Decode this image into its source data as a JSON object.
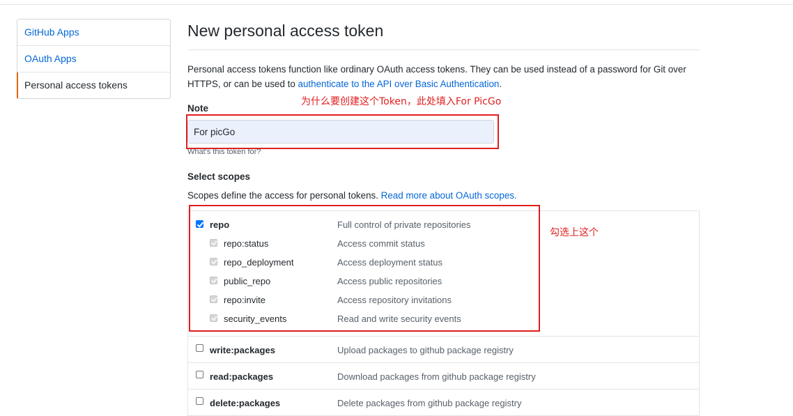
{
  "sidebar": {
    "items": [
      {
        "label": "GitHub Apps"
      },
      {
        "label": "OAuth Apps"
      },
      {
        "label": "Personal access tokens"
      }
    ]
  },
  "main": {
    "title": "New personal access token",
    "intro_text": "Personal access tokens function like ordinary OAuth access tokens. They can be used instead of a password for Git over HTTPS, or can be used to ",
    "intro_link": "authenticate to the API over Basic Authentication",
    "intro_end": ".",
    "note_label": "Note",
    "note_value": "For picGo",
    "note_hint": "What's this token for?",
    "scopes_label": "Select scopes",
    "scopes_desc": "Scopes define the access for personal tokens. ",
    "scopes_link": "Read more about OAuth scopes."
  },
  "annotations": {
    "note": "为什么要创建这个Token，此处填入For PicGo",
    "repo": "勾选上这个",
    "color": "#e01e1e"
  },
  "scopes": {
    "repo": {
      "name": "repo",
      "desc": "Full control of private repositories",
      "checked": true
    },
    "repo_children": [
      {
        "name": "repo:status",
        "desc": "Access commit status"
      },
      {
        "name": "repo_deployment",
        "desc": "Access deployment status"
      },
      {
        "name": "public_repo",
        "desc": "Access public repositories"
      },
      {
        "name": "repo:invite",
        "desc": "Access repository invitations"
      },
      {
        "name": "security_events",
        "desc": "Read and write security events"
      }
    ],
    "packages": [
      {
        "name": "write:packages",
        "desc": "Upload packages to github package registry",
        "checked": false
      },
      {
        "name": "read:packages",
        "desc": "Download packages from github package registry",
        "checked": false
      },
      {
        "name": "delete:packages",
        "desc": "Delete packages from github package registry",
        "checked": false
      }
    ]
  },
  "colors": {
    "link": "#0366d6",
    "selected_accent": "#e36209",
    "checkbox_checked": "#0075ff"
  }
}
